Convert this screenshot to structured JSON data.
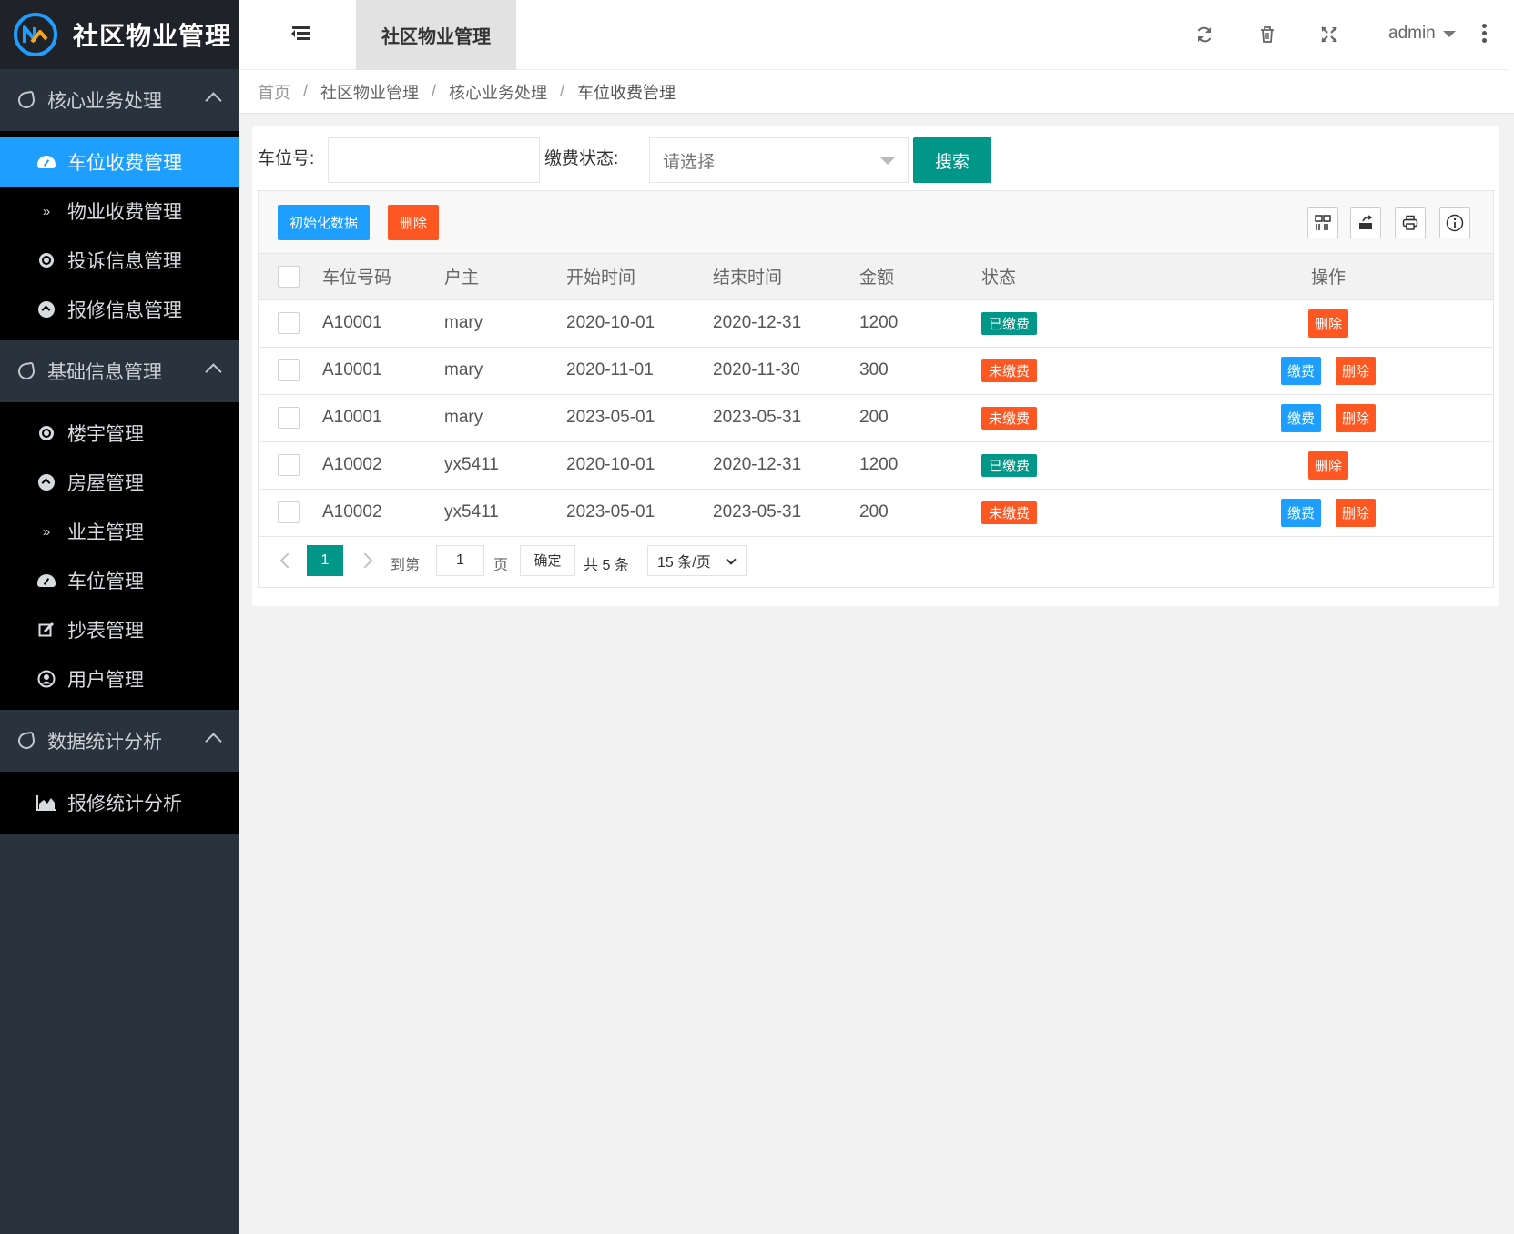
{
  "app": {
    "title": "社区物业管理",
    "tab_title": "社区物业管理",
    "user": "admin"
  },
  "sidebar": {
    "groups": [
      {
        "label": "核心业务处理",
        "items": [
          {
            "label": "车位收费管理",
            "icon": "dashboard-icon",
            "active": true
          },
          {
            "label": "物业收费管理",
            "icon": "double-chevron-down-icon"
          },
          {
            "label": "投诉信息管理",
            "icon": "target-icon"
          },
          {
            "label": "报修信息管理",
            "icon": "circle-up-icon"
          }
        ]
      },
      {
        "label": "基础信息管理",
        "items": [
          {
            "label": "楼宇管理",
            "icon": "target-icon"
          },
          {
            "label": "房屋管理",
            "icon": "circle-up-icon"
          },
          {
            "label": "业主管理",
            "icon": "double-chevron-down-icon"
          },
          {
            "label": "车位管理",
            "icon": "dashboard-icon"
          },
          {
            "label": "抄表管理",
            "icon": "edit-icon"
          },
          {
            "label": "用户管理",
            "icon": "user-circle-icon"
          }
        ]
      },
      {
        "label": "数据统计分析",
        "items": [
          {
            "label": "报修统计分析",
            "icon": "area-chart-icon"
          }
        ]
      }
    ]
  },
  "breadcrumb": [
    "首页",
    "社区物业管理",
    "核心业务处理",
    "车位收费管理"
  ],
  "search": {
    "space_label": "车位号:",
    "space_value": "",
    "status_label": "缴费状态:",
    "status_placeholder": "请选择",
    "search_button": "搜索"
  },
  "toolbar": {
    "init_button": "初始化数据",
    "delete_button": "删除",
    "icons": [
      "columns-icon",
      "export-icon",
      "print-icon",
      "info-icon"
    ]
  },
  "table": {
    "columns": [
      "车位号码",
      "户主",
      "开始时间",
      "结束时间",
      "金额",
      "状态",
      "操作"
    ],
    "rows": [
      {
        "space": "A10001",
        "owner": "mary",
        "start": "2020-10-01",
        "end": "2020-12-31",
        "amount": "1200",
        "status": "已缴费",
        "paid": true
      },
      {
        "space": "A10001",
        "owner": "mary",
        "start": "2020-11-01",
        "end": "2020-11-30",
        "amount": "300",
        "status": "未缴费",
        "paid": false
      },
      {
        "space": "A10001",
        "owner": "mary",
        "start": "2023-05-01",
        "end": "2023-05-31",
        "amount": "200",
        "status": "未缴费",
        "paid": false
      },
      {
        "space": "A10002",
        "owner": "yx5411",
        "start": "2020-10-01",
        "end": "2020-12-31",
        "amount": "1200",
        "status": "已缴费",
        "paid": true
      },
      {
        "space": "A10002",
        "owner": "yx5411",
        "start": "2023-05-01",
        "end": "2023-05-31",
        "amount": "200",
        "status": "未缴费",
        "paid": false
      }
    ],
    "pay_label": "缴费",
    "delete_label": "删除"
  },
  "pager": {
    "current_page": "1",
    "goto_label": "到第",
    "goto_value": "1",
    "page_unit": "页",
    "confirm": "确定",
    "total": "共 5 条",
    "page_size": "15 条/页"
  },
  "colors": {
    "sidebar_bg": "#28333e",
    "active_blue": "#1e9fff",
    "primary_green": "#009688",
    "danger_orange": "#ff5722"
  }
}
